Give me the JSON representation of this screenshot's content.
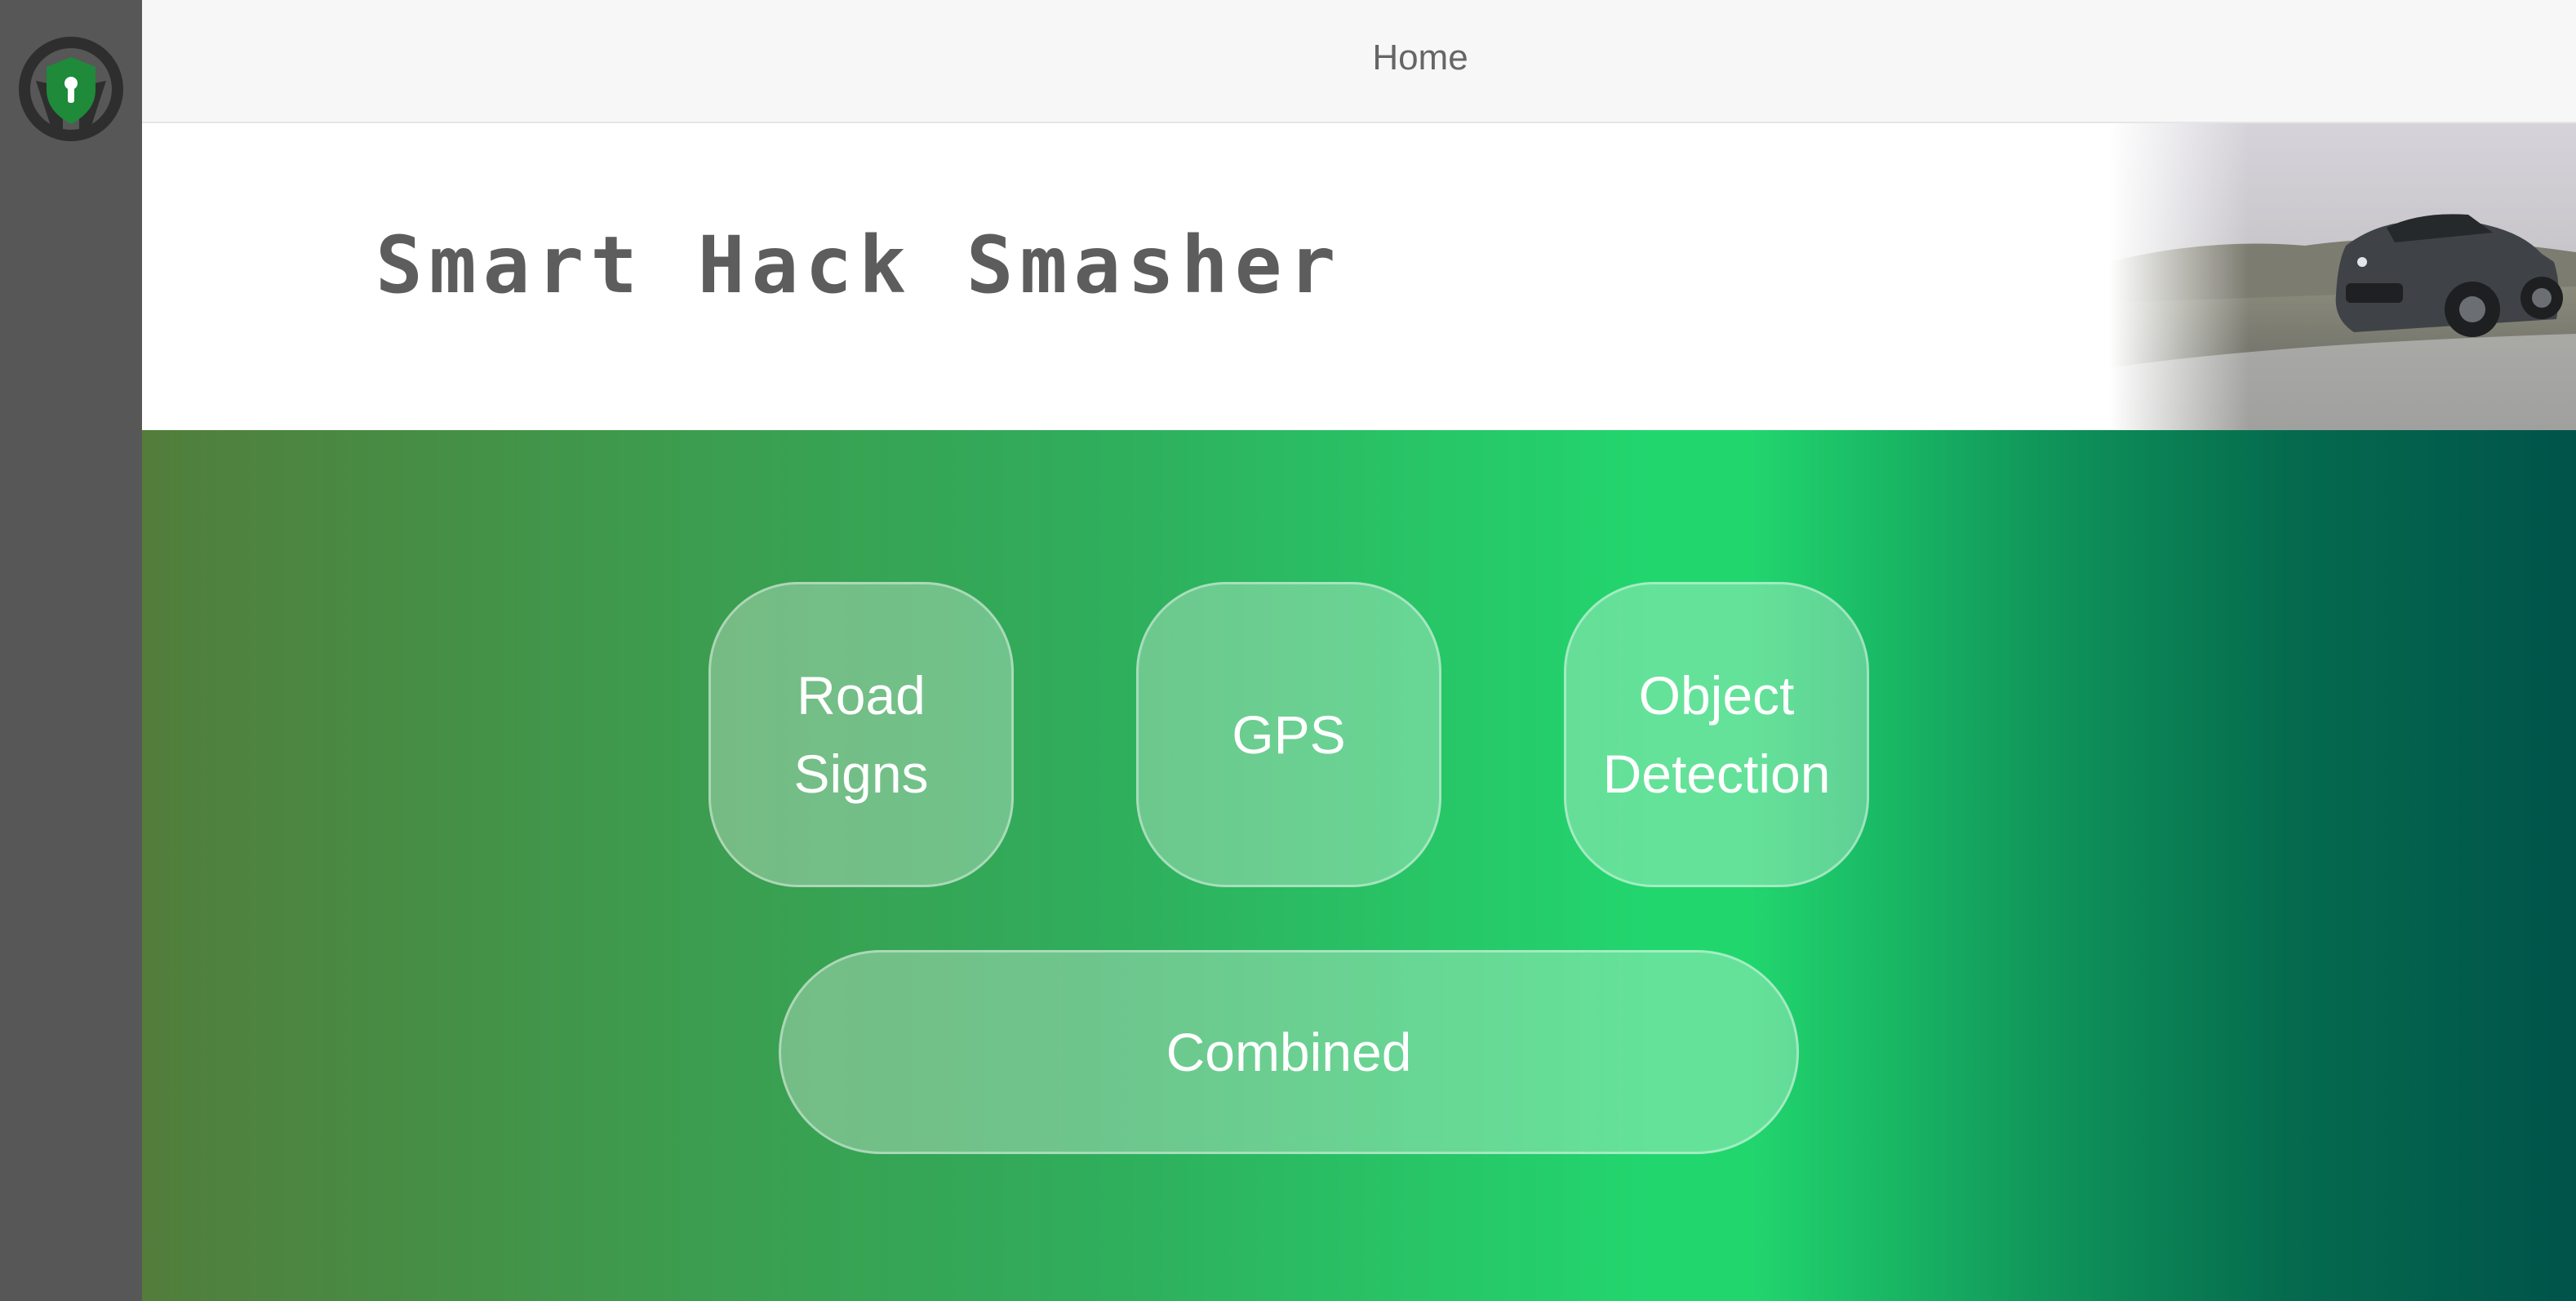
{
  "nav": {
    "home_label": "Home"
  },
  "header": {
    "title": "Smart Hack Smasher"
  },
  "icons": {
    "logo": "steering-wheel-lock-icon"
  },
  "buttons": {
    "road_signs": "Road\nSigns",
    "gps": "GPS",
    "object_detection": "Object\nDetection",
    "combined": "Combined"
  },
  "colors": {
    "sidebar": "#575757",
    "logo_shield": "#1e8a3a",
    "gradient_start": "#527d3b",
    "gradient_mid": "#22d66e",
    "gradient_end": "#00534a"
  }
}
